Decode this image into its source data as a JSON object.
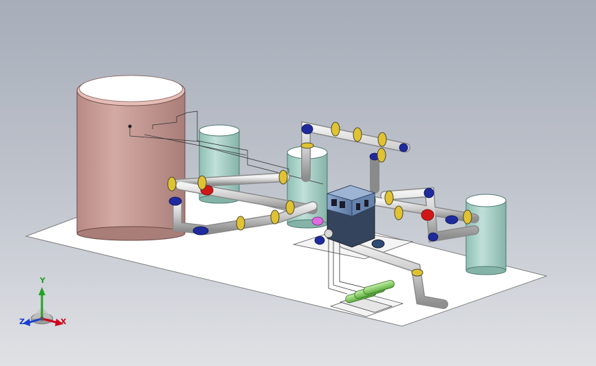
{
  "triad": {
    "x_label": "X",
    "y_label": "Y",
    "z_label": "Z"
  },
  "colors": {
    "background_top": "#a7adb9",
    "background_bottom": "#dfe1e5",
    "floor": "#ffffff",
    "large_tank": "#c69a95",
    "small_tanks": "#a9d0c6",
    "pipe": "#dcdcdc",
    "elbow": "#1f2a9c",
    "valve": "#d01818",
    "flange": "#e0c233",
    "pump_housing": "#7c98bf",
    "cylinders": "#8fd16e",
    "x_axis": "#d0021b",
    "y_axis": "#22a122",
    "z_axis": "#1b3fd0"
  },
  "icons": [
    "coordinate-triad-icon"
  ]
}
